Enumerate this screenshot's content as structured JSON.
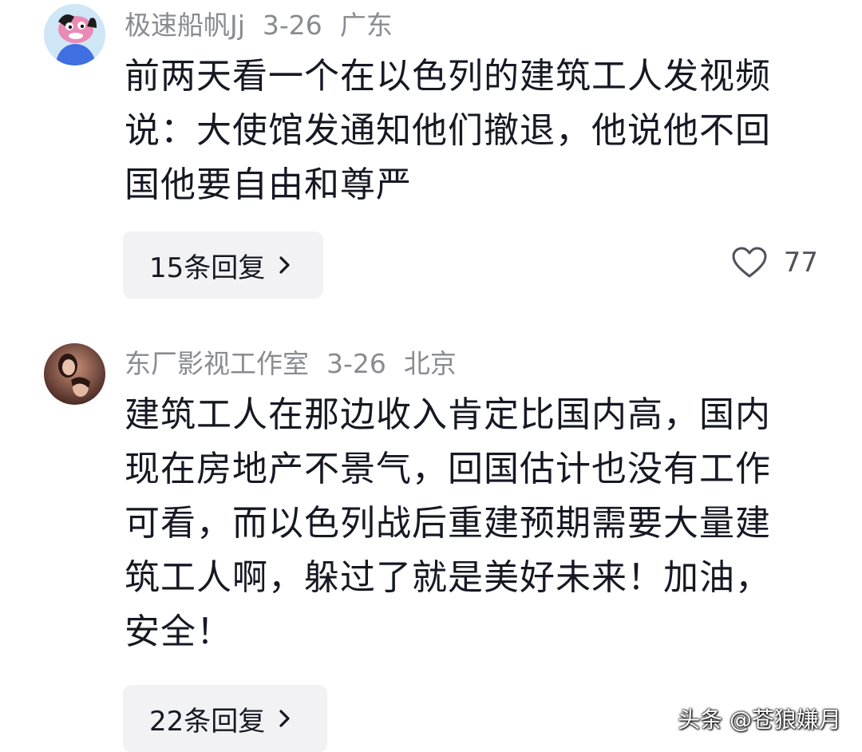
{
  "comments": [
    {
      "username": "极速船帆Jj",
      "date": "3-26",
      "location": "广东",
      "text": "前两天看一个在以色列的建筑工人发视频说：大使馆发通知他们撤退，他说他不回国他要自由和尊严",
      "replies_label": "15条回复",
      "likes": "77",
      "avatar_icon": "cartoon-dog-avatar"
    },
    {
      "username": "东厂影视工作室",
      "date": "3-26",
      "location": "北京",
      "text": "建筑工人在那边收入肯定比国内高，国内现在房地产不景气，回国估计也没有工作可看，而以色列战后重建预期需要大量建筑工人啊，躲过了就是美好未来！加油，安全！",
      "replies_label": "22条回复",
      "avatar_icon": "photo-avatar"
    }
  ],
  "watermark": "头条 @苍狼嫌月",
  "colors": {
    "meta": "#8a8b91",
    "text": "#161823",
    "reply_bg": "#f2f2f4"
  }
}
